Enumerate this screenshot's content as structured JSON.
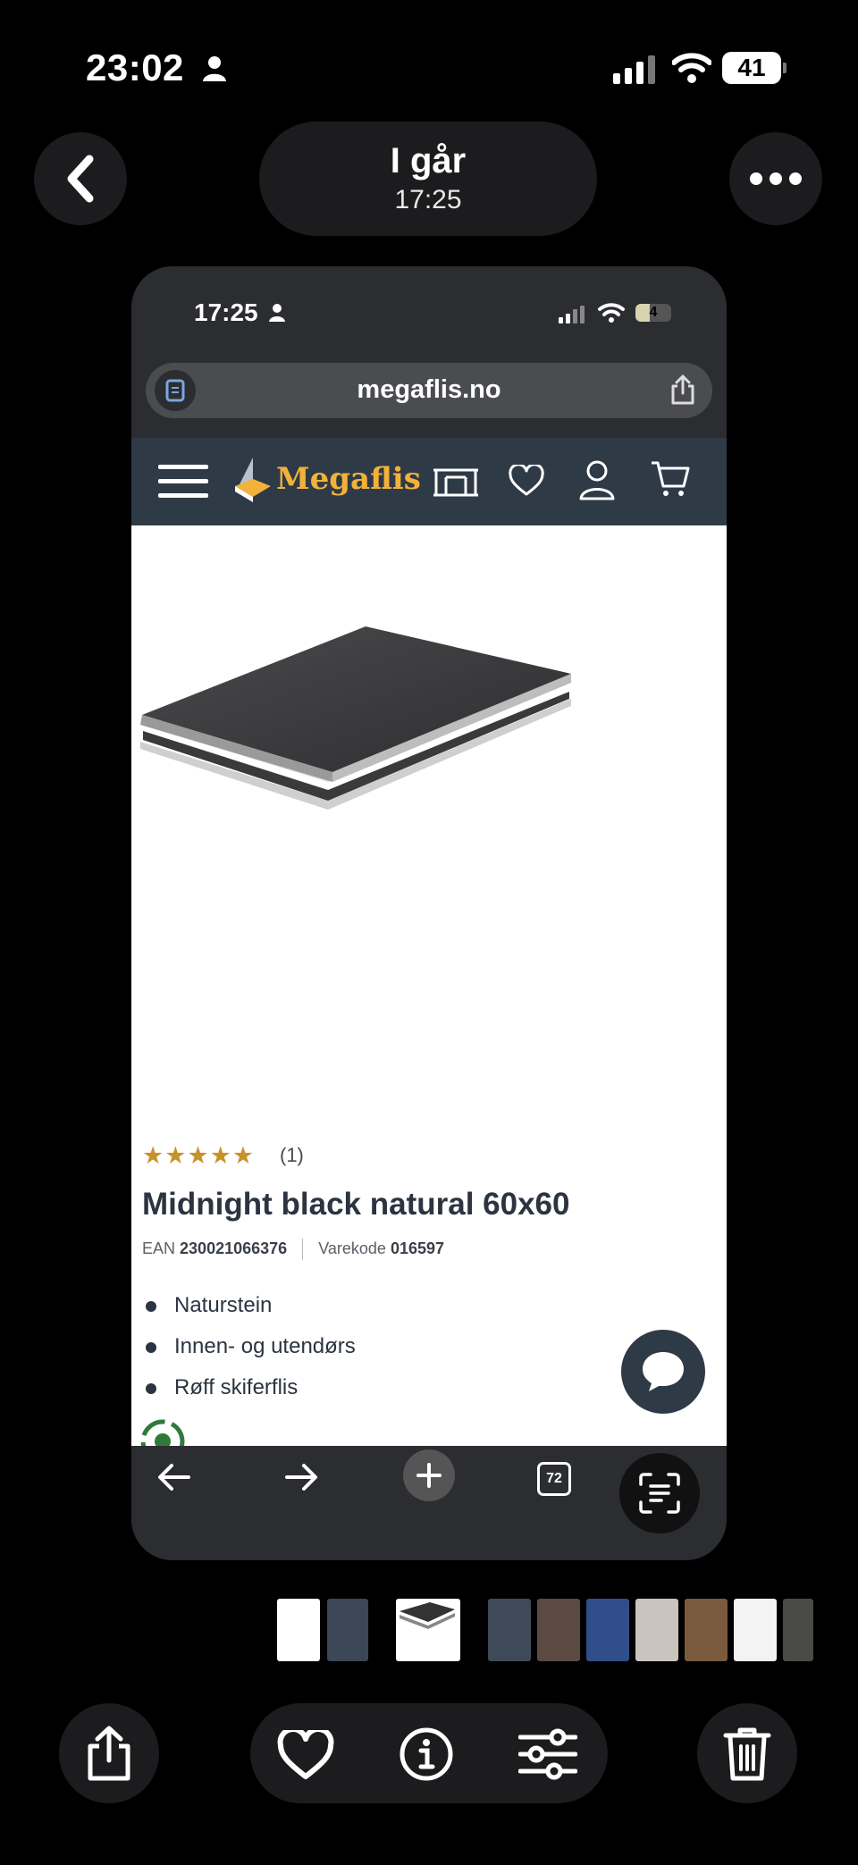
{
  "status_bar": {
    "time": "23:02",
    "battery": "41"
  },
  "photo_header": {
    "day": "I går",
    "time": "17:25"
  },
  "inner": {
    "status_bar": {
      "time": "17:25",
      "battery": "4"
    },
    "browser": {
      "url": "megaflis.no",
      "tabs_count": "72"
    },
    "site": {
      "logo": "Megaflis"
    },
    "product": {
      "rating_count": "(1)",
      "title": "Midnight black natural 60x60",
      "ean_label": "EAN",
      "ean_value": "230021066376",
      "sku_label": "Varekode",
      "sku_value": "016597",
      "bullets": [
        "Naturstein",
        "Innen- og utendørs",
        "Røff skiferflis"
      ]
    }
  },
  "colors": {
    "brand_yellow": "#f2b23a",
    "nav_navy": "#2f3a47",
    "star_gold": "#c8922a"
  },
  "icons": [
    "back-icon",
    "more-icon",
    "share-icon",
    "heart-icon",
    "info-icon",
    "adjust-icon",
    "trash-icon"
  ]
}
